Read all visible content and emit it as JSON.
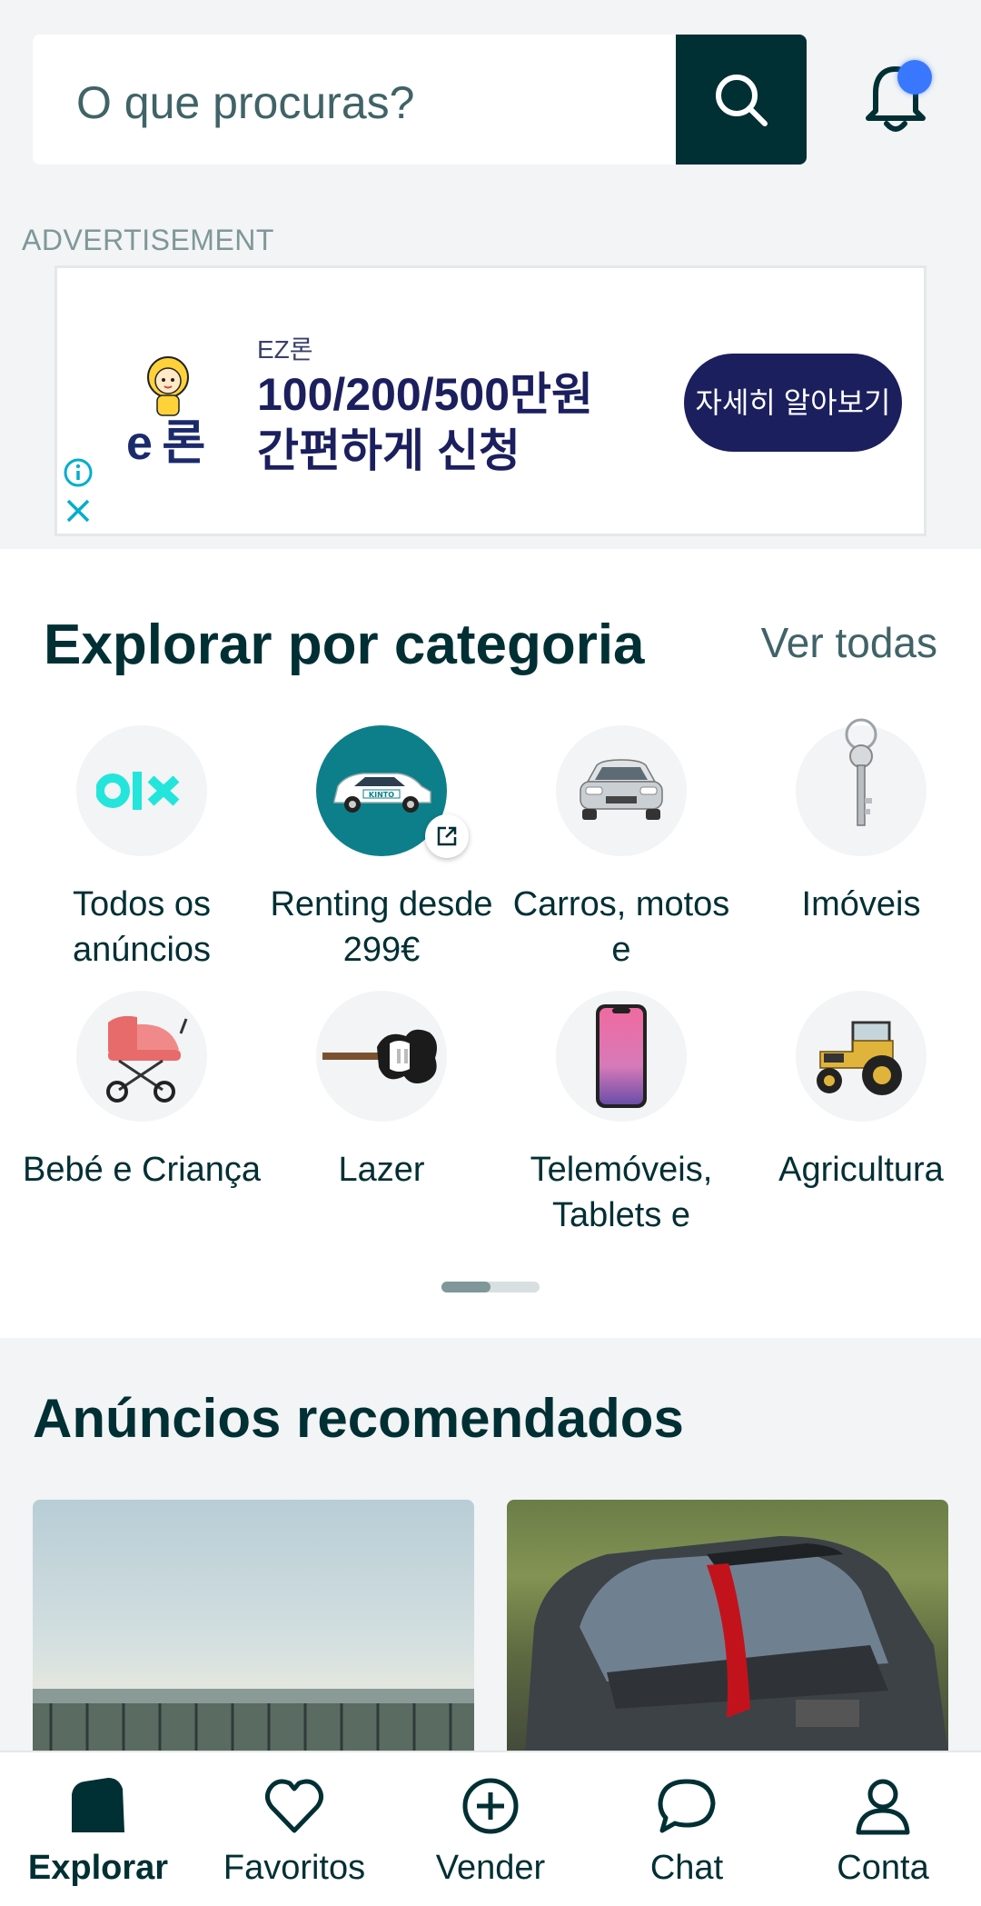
{
  "search": {
    "placeholder": "O que procuras?"
  },
  "ad": {
    "label": "ADVERTISEMENT",
    "brand_small": "EZ론",
    "logo_text": "e 론",
    "headline": "100/200/500만원 간편하게 신청",
    "cta": "자세히 알아보기"
  },
  "categories": {
    "title": "Explorar por categoria",
    "view_all": "Ver todas",
    "items": [
      {
        "label": "Todos os anúncios",
        "icon": "olx-logo-icon"
      },
      {
        "label": "Renting desde 299€",
        "icon": "kinto-car-icon"
      },
      {
        "label": "Carros, motos e",
        "icon": "car-icon"
      },
      {
        "label": "Imóveis",
        "icon": "key-icon"
      },
      {
        "label": "Bebé e Criança",
        "icon": "stroller-icon"
      },
      {
        "label": "Lazer",
        "icon": "guitar-icon"
      },
      {
        "label": "Telemóveis, Tablets e",
        "icon": "phone-icon"
      },
      {
        "label": "Agricultura",
        "icon": "tractor-icon"
      }
    ],
    "page_indicator": {
      "current": 1,
      "total": 2
    }
  },
  "recommended": {
    "title": "Anúncios recomendados"
  },
  "nav": {
    "items": [
      {
        "label": "Explorar",
        "icon": "home-icon",
        "active": true
      },
      {
        "label": "Favoritos",
        "icon": "heart-icon",
        "active": false
      },
      {
        "label": "Vender",
        "icon": "plus-circle-icon",
        "active": false
      },
      {
        "label": "Chat",
        "icon": "chat-bubble-icon",
        "active": false
      },
      {
        "label": "Conta",
        "icon": "user-icon",
        "active": false
      }
    ]
  },
  "colors": {
    "primary": "#002f34",
    "accent": "#23e5db",
    "notification": "#3a77ff"
  }
}
